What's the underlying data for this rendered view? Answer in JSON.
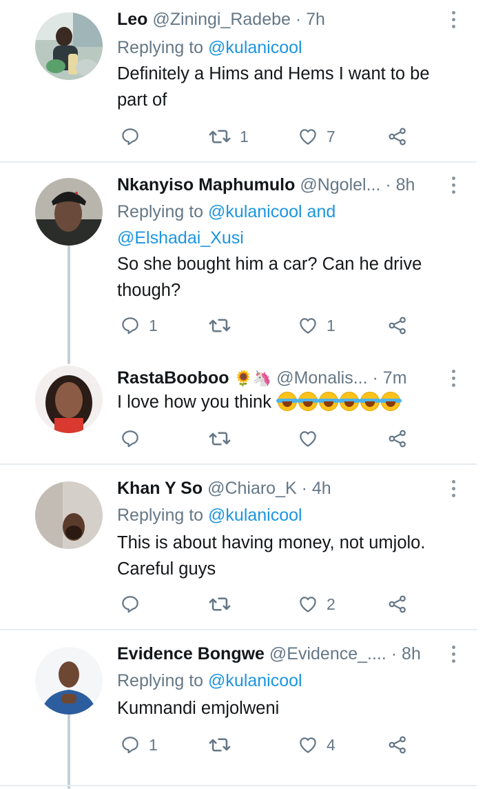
{
  "tweets": [
    {
      "name": "Leo",
      "handle": "@Ziningi_Radebe",
      "time": "· 7h",
      "replying_prefix": "Replying to",
      "replying_to": "@kulanicool",
      "replying_to_2": "",
      "text_lines": [
        "Definitely a Hims and Hems I want to be",
        "part of"
      ],
      "replies": "",
      "retweets": "1",
      "likes": "7"
    },
    {
      "name": "Nkanyiso Maphumulo",
      "handle": "@Ngolel...",
      "time": "· 8h",
      "replying_prefix": "Replying to",
      "replying_to": "@kulanicool and",
      "replying_to_2": "@Elshadai_Xusi",
      "text_lines": [
        "So she bought him a car? Can he drive",
        "though?"
      ],
      "replies": "1",
      "retweets": "",
      "likes": "1"
    },
    {
      "name": "RastaBooboo",
      "name_emoji": "🌻🦄",
      "handle": "@Monalis...",
      "time": "· 7m",
      "text_lines": [
        "I love how you think"
      ],
      "replies": "",
      "retweets": "",
      "likes": ""
    },
    {
      "name": "Khan Y So",
      "handle": "@Chiaro_K",
      "time": "· 4h",
      "replying_prefix": "Replying to",
      "replying_to": "@kulanicool",
      "text_lines": [
        "This is about having money, not umjolo.",
        "Careful guys"
      ],
      "replies": "",
      "retweets": "",
      "likes": "2"
    },
    {
      "name": "Evidence Bongwe",
      "handle": "@Evidence_....",
      "time": "· 8h",
      "replying_prefix": "Replying to",
      "replying_to": "@kulanicool",
      "text_lines": [
        "Kumnandi emjolweni"
      ],
      "replies": "1",
      "retweets": "",
      "likes": "4"
    }
  ],
  "colors": {
    "text": "#14171a",
    "secondary": "#657786",
    "link": "#1b95e0",
    "divider": "#e6ecf0",
    "thread_line": "#c4cfd6"
  },
  "icons": [
    "reply-icon",
    "retweet-icon",
    "like-icon",
    "share-icon",
    "more-icon"
  ]
}
